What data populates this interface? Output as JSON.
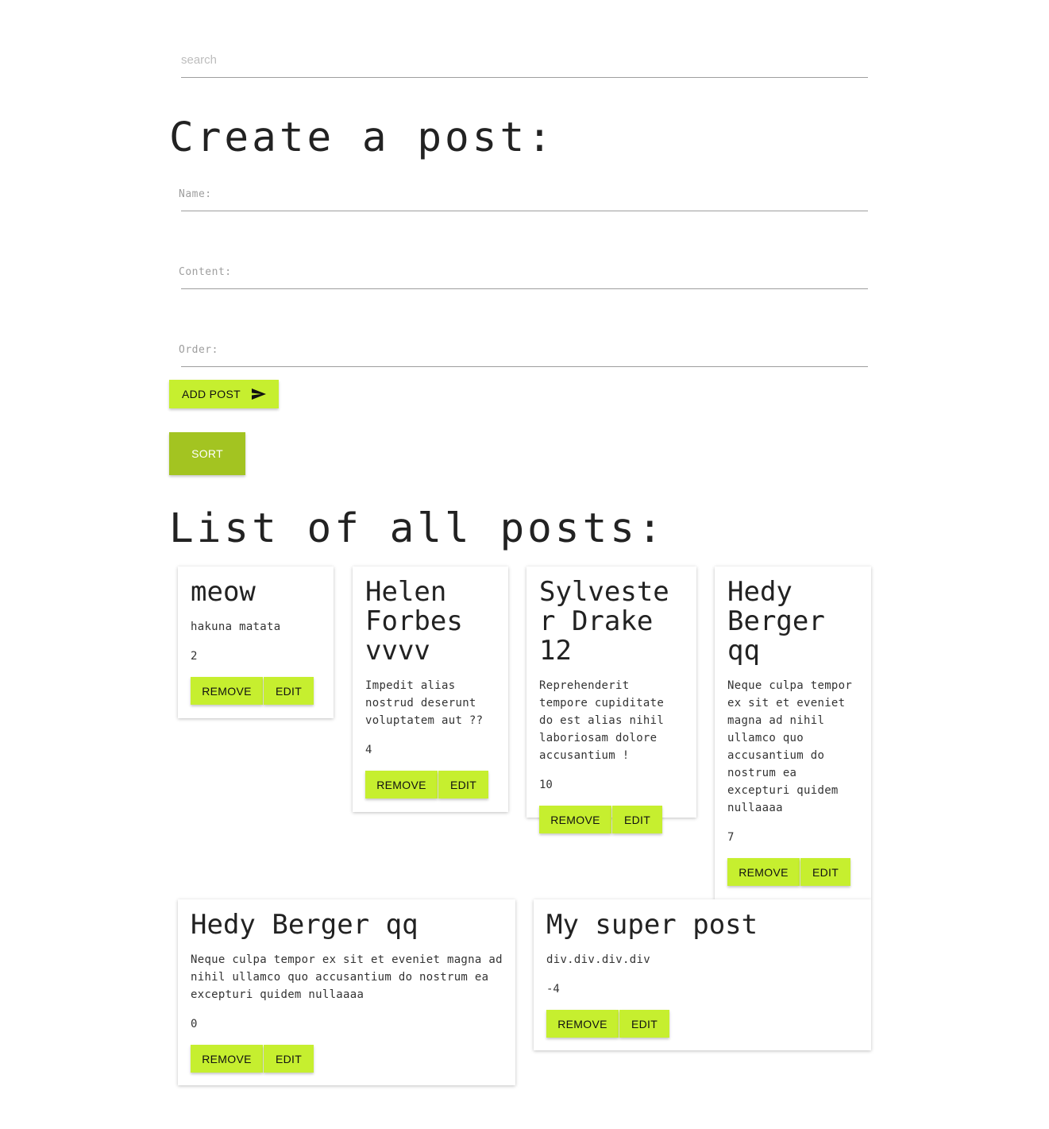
{
  "search": {
    "placeholder": "search"
  },
  "create": {
    "heading": "Create a post:",
    "name_label": "Name:",
    "content_label": "Content:",
    "order_label": "Order:",
    "add_button": "ADD POST",
    "add_icon": "send-icon"
  },
  "sort_button": "SORT",
  "list": {
    "heading": "List of all posts:",
    "remove_label": "REMOVE",
    "edit_label": "EDIT",
    "posts": [
      {
        "title": "meow",
        "content": "hakuna matata",
        "order": "2"
      },
      {
        "title": "Helen Forbes vvvv",
        "content": "Impedit alias nostrud deserunt voluptatem aut ??",
        "order": "4"
      },
      {
        "title": "Sylvester Drake 12",
        "content": "Reprehenderit tempore cupiditate do est alias nihil laboriosam dolore accusantium !",
        "order": "10"
      },
      {
        "title": "Hedy Berger qq",
        "content": "Neque culpa tempor ex sit et eveniet magna ad nihil ullamco quo accusantium do nostrum ea excepturi quidem nullaaaa",
        "order": "7"
      },
      {
        "title": "Hedy Berger qq",
        "content": "Neque culpa tempor ex sit et eveniet magna ad nihil ullamco quo accusantium do nostrum ea excepturi quidem nullaaaa",
        "order": "0"
      },
      {
        "title": "My super post",
        "content": "div.div.div.div",
        "order": "-4"
      }
    ]
  },
  "colors": {
    "accent": "#c6ef2f",
    "sort": "#a3c421"
  }
}
